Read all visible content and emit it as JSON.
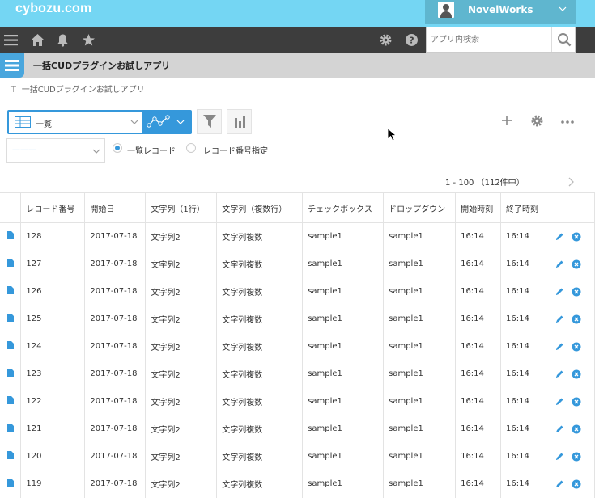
{
  "brand": {
    "logo": "cybozu.com"
  },
  "user": {
    "name": "NovelWorks"
  },
  "search": {
    "placeholder": "アプリ内検索"
  },
  "app": {
    "title": "一括CUDプラグインお試しアプリ",
    "breadcrumb": "一括CUDプラグインお試しアプリ"
  },
  "view": {
    "selected": "一覧"
  },
  "filter": {
    "selected": "———",
    "radio_list": "一覧レコード",
    "radio_number": "レコード番号指定",
    "selected_radio": "一覧レコード"
  },
  "pager": {
    "text": "1 - 100 （112件中）"
  },
  "table": {
    "columns": [
      "レコード番号",
      "開始日",
      "文字列（1行）",
      "文字列（複数行）",
      "チェックボックス",
      "ドロップダウン",
      "開始時刻",
      "終了時刻"
    ],
    "rows": [
      [
        "128",
        "2017-07-18",
        "文字列2",
        "文字列複数",
        "sample1",
        "sample1",
        "16:14",
        "16:14"
      ],
      [
        "127",
        "2017-07-18",
        "文字列2",
        "文字列複数",
        "sample1",
        "sample1",
        "16:14",
        "16:14"
      ],
      [
        "126",
        "2017-07-18",
        "文字列2",
        "文字列複数",
        "sample1",
        "sample1",
        "16:14",
        "16:14"
      ],
      [
        "125",
        "2017-07-18",
        "文字列2",
        "文字列複数",
        "sample1",
        "sample1",
        "16:14",
        "16:14"
      ],
      [
        "124",
        "2017-07-18",
        "文字列2",
        "文字列複数",
        "sample1",
        "sample1",
        "16:14",
        "16:14"
      ],
      [
        "123",
        "2017-07-18",
        "文字列2",
        "文字列複数",
        "sample1",
        "sample1",
        "16:14",
        "16:14"
      ],
      [
        "122",
        "2017-07-18",
        "文字列2",
        "文字列複数",
        "sample1",
        "sample1",
        "16:14",
        "16:14"
      ],
      [
        "121",
        "2017-07-18",
        "文字列2",
        "文字列複数",
        "sample1",
        "sample1",
        "16:14",
        "16:14"
      ],
      [
        "120",
        "2017-07-18",
        "文字列2",
        "文字列複数",
        "sample1",
        "sample1",
        "16:14",
        "16:14"
      ],
      [
        "119",
        "2017-07-18",
        "文字列2",
        "文字列複数",
        "sample1",
        "sample1",
        "16:14",
        "16:14"
      ]
    ]
  },
  "colors": {
    "brand": "#74d6f3",
    "accent": "#3598db",
    "nav": "#3d3d3d"
  },
  "icons": [
    "menu-icon",
    "home-icon",
    "bell-icon",
    "star-icon",
    "gear-icon",
    "help-icon",
    "search-icon",
    "filter-icon",
    "graph-icon",
    "plus-icon",
    "more-icon",
    "pencil-icon",
    "delete-icon",
    "document-icon"
  ]
}
